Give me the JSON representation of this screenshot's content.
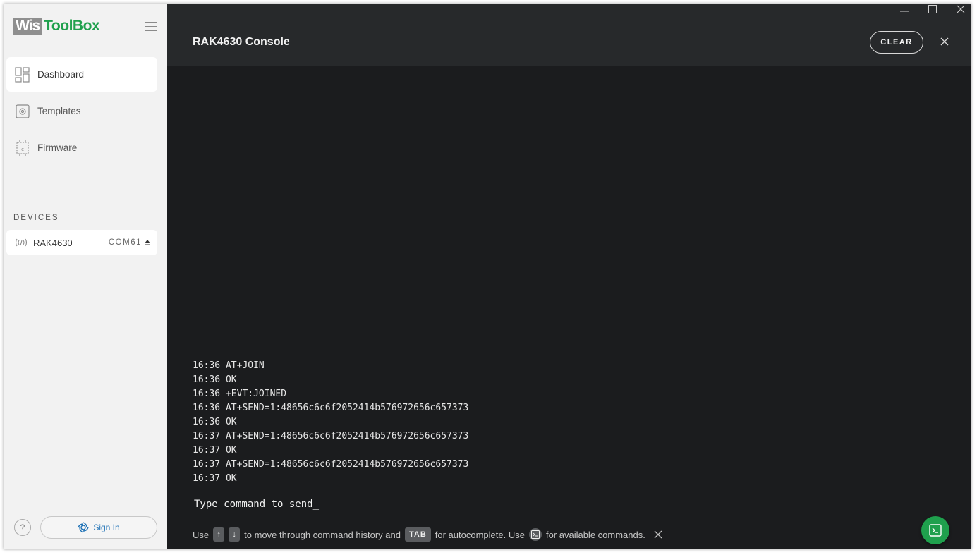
{
  "app": {
    "logo_wis": "Wis",
    "logo_toolbox": "ToolBox"
  },
  "sidebar": {
    "items": [
      {
        "label": "Dashboard",
        "icon": "dashboard-icon",
        "active": true
      },
      {
        "label": "Templates",
        "icon": "templates-icon",
        "active": false
      },
      {
        "label": "Firmware",
        "icon": "firmware-icon",
        "active": false
      }
    ],
    "devices_title": "DEVICES",
    "device": {
      "name": "RAK4630",
      "port": "COM61"
    },
    "help_label": "?",
    "signin_label": "Sign In"
  },
  "console": {
    "title": "RAK4630 Console",
    "clear_label": "CLEAR",
    "log": [
      "16:36 AT+JOIN",
      "16:36 OK",
      "16:36 +EVT:JOINED",
      "16:36 AT+SEND=1:48656c6c6f2052414b576972656c657373",
      "16:36 OK",
      "16:37 AT+SEND=1:48656c6c6f2052414b576972656c657373",
      "16:37 OK",
      "16:37 AT+SEND=1:48656c6c6f2052414b576972656c657373",
      "16:37 OK"
    ],
    "input_placeholder": "Type command to send_",
    "hint": {
      "use": "Use",
      "up_key": "↑",
      "down_key": "↓",
      "history_text": "to move through command history and",
      "tab_key": "TAB",
      "autocomplete_text": "for autocomplete. Use",
      "commands_text": "for available commands."
    }
  },
  "colors": {
    "accent": "#1fa04d",
    "console_bg": "#1b1c1e",
    "header_bg": "#27292b"
  }
}
